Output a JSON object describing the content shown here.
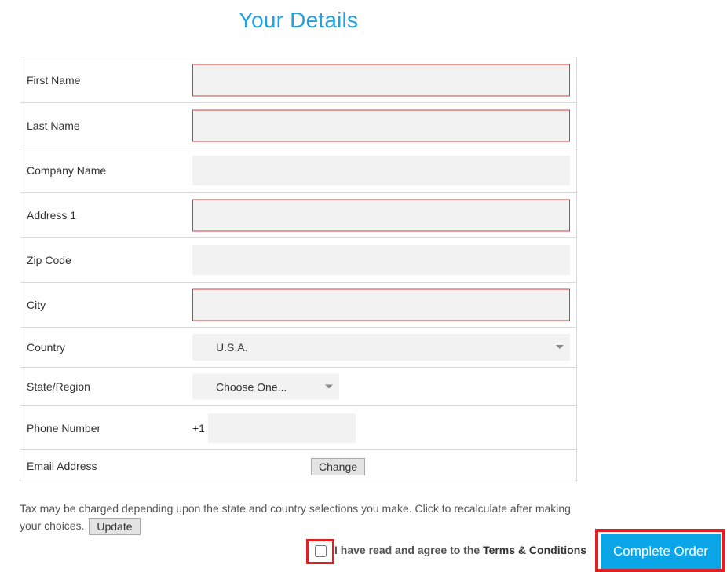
{
  "page": {
    "title": "Your Details"
  },
  "form": {
    "first_name": {
      "label": "First Name",
      "value": ""
    },
    "last_name": {
      "label": "Last Name",
      "value": ""
    },
    "company_name": {
      "label": "Company Name",
      "value": ""
    },
    "address1": {
      "label": "Address 1",
      "value": ""
    },
    "zip": {
      "label": "Zip Code",
      "value": ""
    },
    "city": {
      "label": "City",
      "value": ""
    },
    "country": {
      "label": "Country",
      "selected": "U.S.A."
    },
    "state": {
      "label": "State/Region",
      "selected": "Choose One..."
    },
    "phone": {
      "label": "Phone Number",
      "prefix": "+1",
      "value": ""
    },
    "email": {
      "label": "Email Address",
      "change_label": "Change"
    }
  },
  "tax_note": {
    "text": "Tax may be charged depending upon the state and country selections you make. Click to recalculate after making your choices.",
    "update_label": "Update"
  },
  "terms": {
    "prefix": "I have read and agree to the ",
    "link": "Terms & Conditions",
    "checked": false
  },
  "actions": {
    "complete_order": "Complete Order"
  },
  "colors": {
    "accent": "#1ea3e0",
    "primary_button": "#0aa5e7",
    "error_border": "#d93b3b",
    "highlight_border": "#e01e24"
  }
}
